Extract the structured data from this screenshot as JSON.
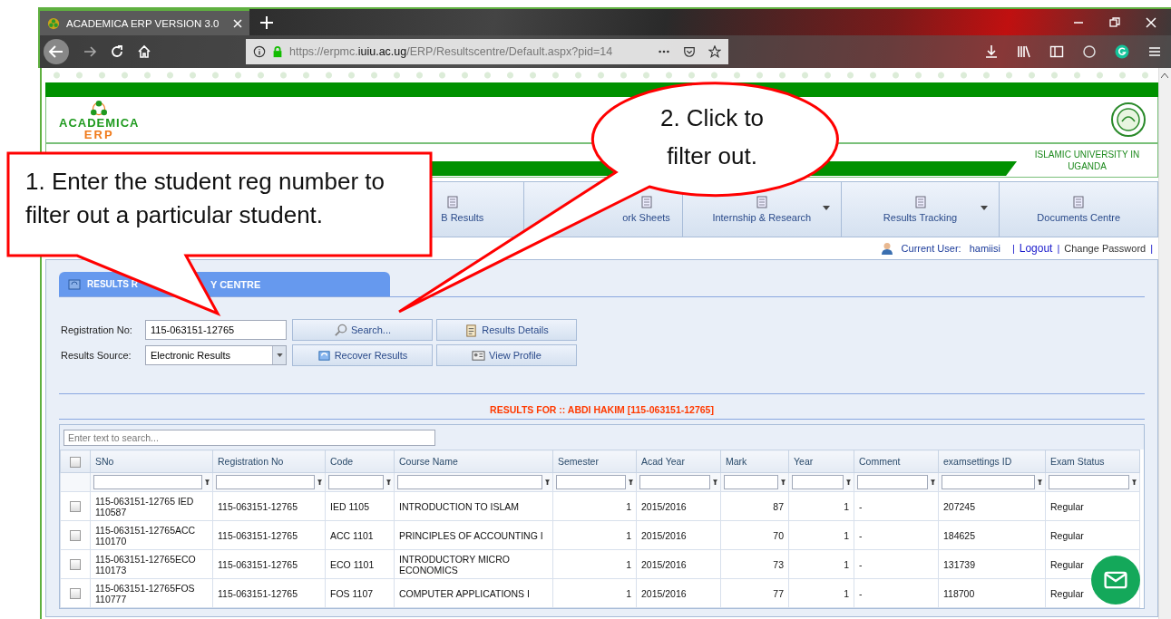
{
  "browser": {
    "tab_title": "ACADEMICA ERP VERSION 3.0",
    "url": "https://erpmc.**iuiu.ac.ug**/ERP/Resultscentre/Default.aspx?pid=14"
  },
  "header": {
    "logo_top": "ACADEMICA",
    "logo_bottom": "ERP",
    "university": "ISLAMIC UNIVERSITY IN UGANDA"
  },
  "nav": [
    {
      "label": "B Results",
      "dropdown": false
    },
    {
      "label": "ork Sheets",
      "dropdown": false
    },
    {
      "label": "Internship & Research",
      "dropdown": true
    },
    {
      "label": "Results Tracking",
      "dropdown": true
    },
    {
      "label": "Documents Centre",
      "dropdown": false
    }
  ],
  "user_bar": {
    "label": "Current User:",
    "name": "hamiisi",
    "links": [
      {
        "kind": "sep",
        "text": "|"
      },
      {
        "kind": "link",
        "text": "Logout"
      },
      {
        "kind": "sep",
        "text": "|"
      },
      {
        "kind": "plain",
        "text": "Change Password"
      },
      {
        "kind": "sep",
        "text": "|"
      }
    ]
  },
  "panel": {
    "title_parts": [
      "RESULTS R",
      "Y CENTRE"
    ]
  },
  "form": {
    "reg_label": "Registration No:",
    "reg_value": "115-063151-12765",
    "source_label": "Results Source:",
    "source_value": "Electronic Results",
    "buttons": [
      {
        "kind": "search",
        "label": "Search..."
      },
      {
        "kind": "details",
        "label": "Results Details"
      },
      {
        "kind": "recover",
        "label": "Recover Results"
      },
      {
        "kind": "profile",
        "label": "View Profile"
      }
    ]
  },
  "results_title": "RESULTS FOR :: ABDI HAKIM [115-063151-12765]",
  "grid": {
    "search_placeholder": "Enter text to search...",
    "header_checked": false,
    "columns": [
      "SNo",
      "Registration No",
      "Code",
      "Course Name",
      "Semester",
      "Acad Year",
      "Mark",
      "Year",
      "Comment",
      "examsettings ID",
      "Exam Status"
    ],
    "rows": [
      {
        "checked": false,
        "cells": [
          "115-063151-12765 IED 110587",
          "115-063151-12765",
          "IED 1105",
          "INTRODUCTION TO ISLAM",
          "1",
          "2015/2016",
          "87",
          "1",
          "-",
          "207245",
          "Regular"
        ]
      },
      {
        "checked": false,
        "cells": [
          "115-063151-12765ACC 110170",
          "115-063151-12765",
          "ACC 1101",
          "PRINCIPLES OF ACCOUNTING I",
          "1",
          "2015/2016",
          "70",
          "1",
          "-",
          "184625",
          "Regular"
        ]
      },
      {
        "checked": false,
        "cells": [
          "115-063151-12765ECO 110173",
          "115-063151-12765",
          "ECO 1101",
          "INTRODUCTORY MICRO ECONOMICS",
          "1",
          "2015/2016",
          "73",
          "1",
          "-",
          "131739",
          "Regular"
        ]
      },
      {
        "checked": false,
        "cells": [
          "115-063151-12765FOS 110777",
          "115-063151-12765",
          "FOS 1107",
          "COMPUTER APPLICATIONS I",
          "1",
          "2015/2016",
          "77",
          "1",
          "-",
          "118700",
          "Regular"
        ]
      }
    ]
  },
  "callouts": [
    {
      "kind": "rect",
      "text": "1. Enter the student reg number to filter out a particular student."
    },
    {
      "kind": "ellipse",
      "text": "2. Click to filter out."
    }
  ]
}
